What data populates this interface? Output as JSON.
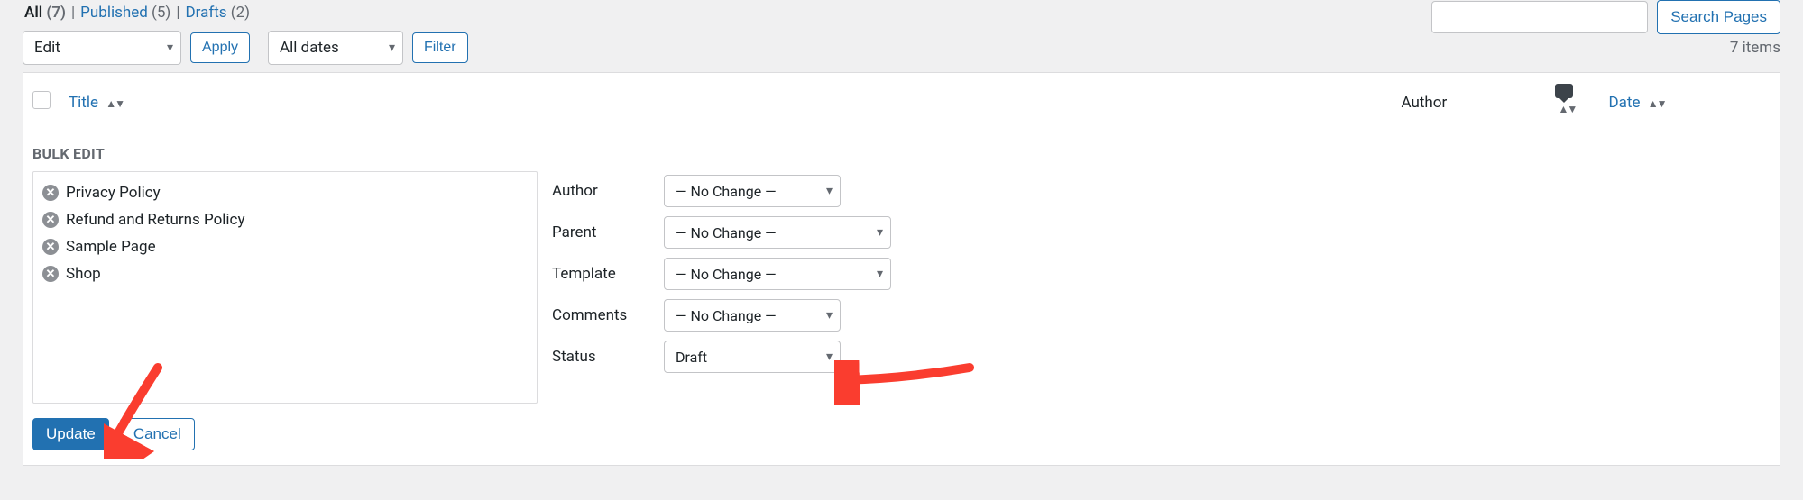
{
  "colors": {
    "accent": "#2271b1",
    "arrow": "#fa3d2f"
  },
  "subsubsub": {
    "all": {
      "label": "All",
      "count": "(7)"
    },
    "published": {
      "label": "Published",
      "count": "(5)"
    },
    "drafts": {
      "label": "Drafts",
      "count": "(2)"
    }
  },
  "search": {
    "placeholder": "",
    "button": "Search Pages"
  },
  "bulk_action": {
    "value": "Edit",
    "apply": "Apply"
  },
  "date_filter": {
    "value": "All dates",
    "filter": "Filter"
  },
  "items_count": "7 items",
  "columns": {
    "title": "Title",
    "author": "Author",
    "comments": "",
    "date": "Date"
  },
  "bulk_edit": {
    "legend": "BULK EDIT",
    "titles": [
      "Privacy Policy",
      "Refund and Returns Policy",
      "Sample Page",
      "Shop"
    ],
    "fields": {
      "author": {
        "label": "Author",
        "value": "— No Change —"
      },
      "parent": {
        "label": "Parent",
        "value": "— No Change —"
      },
      "template": {
        "label": "Template",
        "value": "— No Change —"
      },
      "comments": {
        "label": "Comments",
        "value": "— No Change —"
      },
      "status": {
        "label": "Status",
        "value": "Draft"
      }
    },
    "update": "Update",
    "cancel": "Cancel"
  }
}
